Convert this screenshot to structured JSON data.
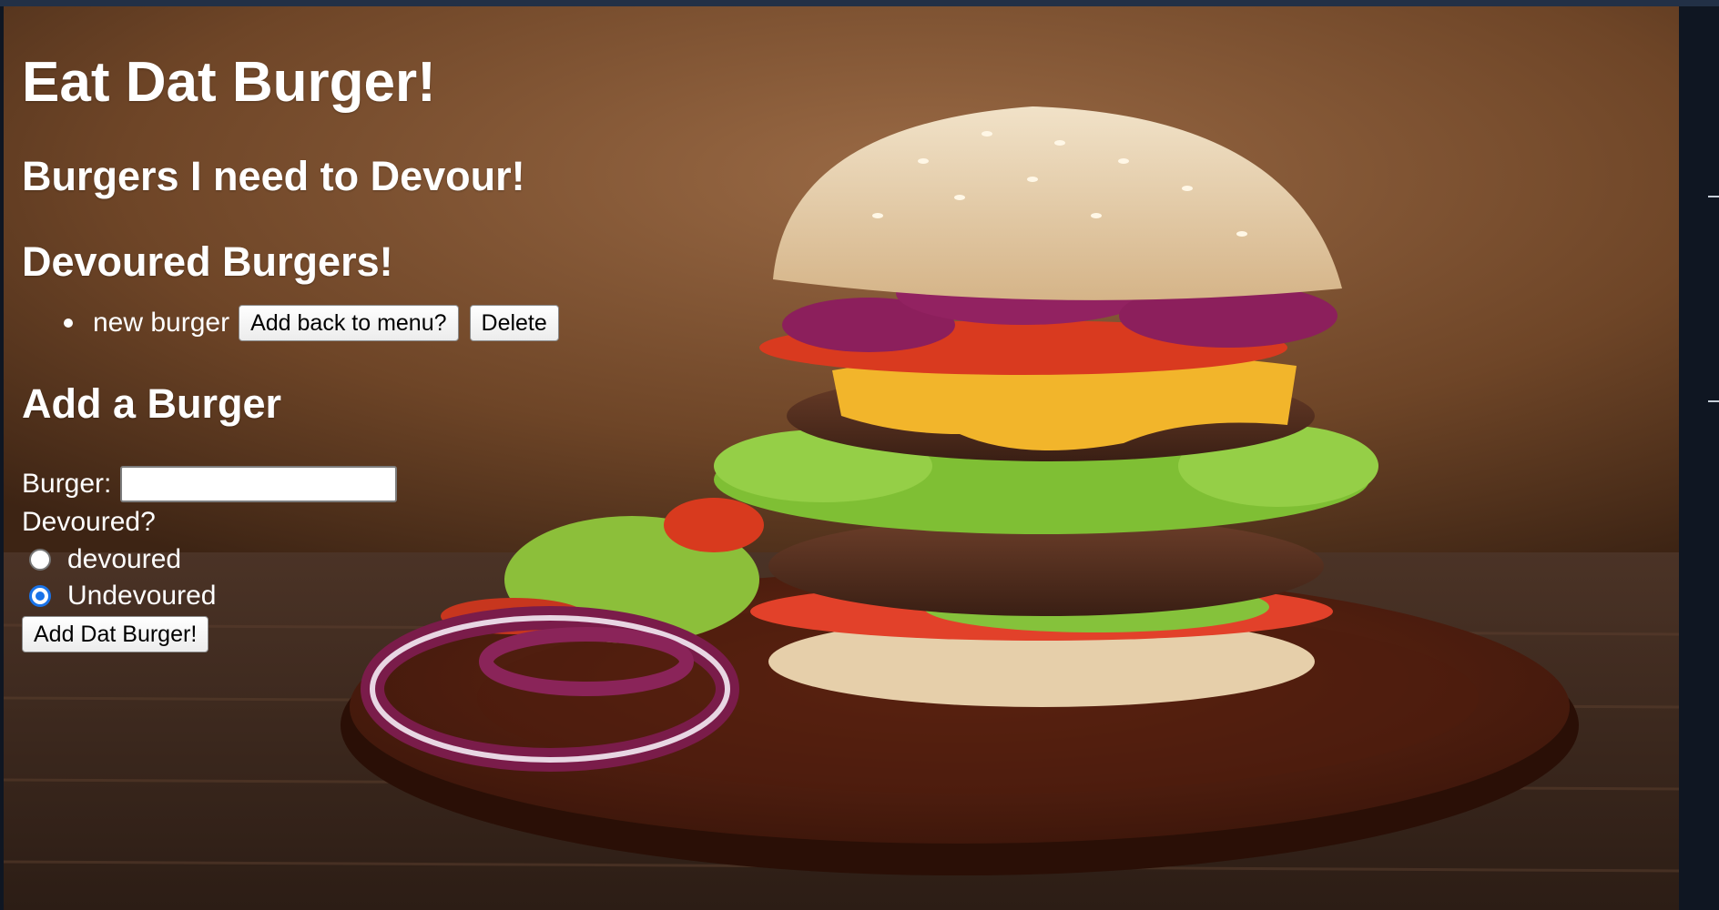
{
  "page": {
    "title": "Eat Dat Burger!"
  },
  "sections": {
    "to_devour_heading": "Burgers I need to Devour!",
    "devoured_heading": "Devoured Burgers!",
    "add_heading": "Add a Burger"
  },
  "devoured_burgers": [
    {
      "name": "new burger",
      "add_back_label": "Add back to menu?",
      "delete_label": "Delete"
    }
  ],
  "form": {
    "burger_label": "Burger:",
    "burger_value": "",
    "devoured_question": "Devoured?",
    "options": [
      {
        "label": "devoured",
        "checked": false
      },
      {
        "label": "Undevoured",
        "checked": true
      }
    ],
    "submit_label": "Add Dat Burger!"
  },
  "colors": {
    "heading_text": "#ffffff",
    "radio_accent": "#1a73e8",
    "background_wood": "#6b3b22"
  },
  "background": {
    "subject": "burger-photo"
  }
}
